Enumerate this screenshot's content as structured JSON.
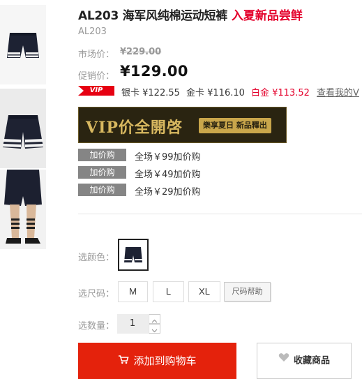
{
  "product": {
    "title": "AL203 海军风纯棉运动短裤",
    "promo_title": "入夏新品尝鲜",
    "sku": "AL203"
  },
  "pricing": {
    "market_label": "市场价：",
    "market_price": "¥229.00",
    "sale_label": "促销价：",
    "sale_price": "¥129.00"
  },
  "vip": {
    "badge": "VIP",
    "tiers": [
      {
        "label": "银卡 ¥122.55"
      },
      {
        "label": "金卡 ¥116.10"
      },
      {
        "label": "白金 ¥113.52"
      }
    ],
    "link": "查看我的V"
  },
  "banner": {
    "main_text": "VIP价全開啓",
    "tag_text": "樂享夏日 新品釋出"
  },
  "addons": [
    {
      "tag": "加价购",
      "text": "全场￥99加价购"
    },
    {
      "tag": "加价购",
      "text": "全场￥49加价购"
    },
    {
      "tag": "加价购",
      "text": "全场￥29加价购"
    }
  ],
  "options": {
    "color_label": "选颜色：",
    "size_label": "选尺码：",
    "sizes": [
      "M",
      "L",
      "XL"
    ],
    "size_help": "尺码帮助",
    "qty_label": "选数量：",
    "qty_value": "1"
  },
  "actions": {
    "add_to_cart": "添加到购物车",
    "favorite": "收藏商品"
  },
  "colors": {
    "accent_red": "#e4002b",
    "cart_button": "#e4220c",
    "addon_tag": "#858585",
    "banner_bg": "#2a2411",
    "banner_gold": "#d8b860"
  },
  "icons": {
    "cart": "cart-icon",
    "favorite": "heart-icon"
  }
}
